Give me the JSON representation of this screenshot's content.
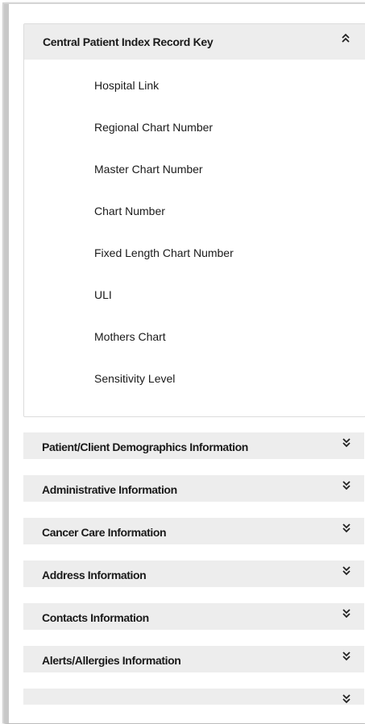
{
  "expanded_section": {
    "title": "Central Patient Index Record Key",
    "toggle_icon": "chevron-double-up",
    "fields": [
      "Hospital Link",
      "Regional Chart Number",
      "Master Chart Number",
      "Chart Number",
      "Fixed Length Chart Number",
      "ULI",
      "Mothers Chart",
      "Sensitivity Level"
    ]
  },
  "collapsed_sections": [
    {
      "title": "Patient/Client Demographics Information",
      "toggle_icon": "chevron-double-down"
    },
    {
      "title": "Administrative Information",
      "toggle_icon": "chevron-double-down"
    },
    {
      "title": "Cancer Care Information",
      "toggle_icon": "chevron-double-down"
    },
    {
      "title": "Address Information",
      "toggle_icon": "chevron-double-down"
    },
    {
      "title": "Contacts Information",
      "toggle_icon": "chevron-double-down"
    },
    {
      "title": "Alerts/Allergies Information",
      "toggle_icon": "chevron-double-down"
    },
    {
      "title": "",
      "toggle_icon": "chevron-double-down"
    }
  ],
  "glyphs": {
    "up": "»",
    "down": "»"
  }
}
